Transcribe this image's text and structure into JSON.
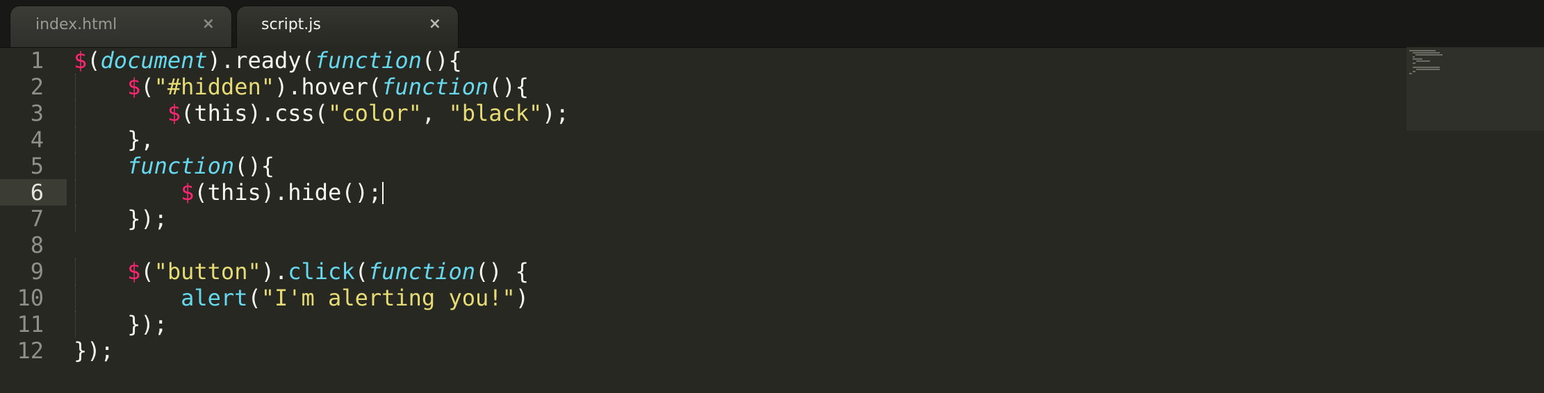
{
  "tabs": [
    {
      "label": "index.html",
      "close_glyph": "×",
      "active": false
    },
    {
      "label": "script.js",
      "close_glyph": "×",
      "active": true
    }
  ],
  "editor": {
    "current_line": 6,
    "lines": [
      {
        "number": "1",
        "tokens": [
          {
            "t": "$",
            "c": "dollar"
          },
          {
            "t": "(",
            "c": "plain"
          },
          {
            "t": "document",
            "c": "fn"
          },
          {
            "t": ").ready(",
            "c": "plain"
          },
          {
            "t": "function",
            "c": "fn"
          },
          {
            "t": "(){",
            "c": "plain"
          }
        ]
      },
      {
        "number": "2",
        "tokens": [
          {
            "t": "    ",
            "c": "plain"
          },
          {
            "t": "$",
            "c": "dollar"
          },
          {
            "t": "(",
            "c": "plain"
          },
          {
            "t": "\"#hidden\"",
            "c": "str"
          },
          {
            "t": ").hover(",
            "c": "plain"
          },
          {
            "t": "function",
            "c": "fn"
          },
          {
            "t": "(){",
            "c": "plain"
          }
        ]
      },
      {
        "number": "3",
        "tokens": [
          {
            "t": "       ",
            "c": "plain"
          },
          {
            "t": "$",
            "c": "dollar"
          },
          {
            "t": "(this).css(",
            "c": "plain"
          },
          {
            "t": "\"color\"",
            "c": "str"
          },
          {
            "t": ", ",
            "c": "plain"
          },
          {
            "t": "\"black\"",
            "c": "str"
          },
          {
            "t": ");",
            "c": "plain"
          }
        ]
      },
      {
        "number": "4",
        "tokens": [
          {
            "t": "    },",
            "c": "plain"
          }
        ]
      },
      {
        "number": "5",
        "tokens": [
          {
            "t": "    ",
            "c": "plain"
          },
          {
            "t": "function",
            "c": "fn"
          },
          {
            "t": "(){",
            "c": "plain"
          }
        ]
      },
      {
        "number": "6",
        "tokens": [
          {
            "t": "        ",
            "c": "plain"
          },
          {
            "t": "$",
            "c": "dollar"
          },
          {
            "t": "(this).hide();",
            "c": "plain"
          }
        ]
      },
      {
        "number": "7",
        "tokens": [
          {
            "t": "    });",
            "c": "plain"
          }
        ]
      },
      {
        "number": "8",
        "tokens": []
      },
      {
        "number": "9",
        "tokens": [
          {
            "t": "    ",
            "c": "plain"
          },
          {
            "t": "$",
            "c": "dollar"
          },
          {
            "t": "(",
            "c": "plain"
          },
          {
            "t": "\"button\"",
            "c": "str"
          },
          {
            "t": ").",
            "c": "plain"
          },
          {
            "t": "click",
            "c": "method"
          },
          {
            "t": "(",
            "c": "plain"
          },
          {
            "t": "function",
            "c": "fn"
          },
          {
            "t": "() {",
            "c": "plain"
          }
        ]
      },
      {
        "number": "10",
        "tokens": [
          {
            "t": "        ",
            "c": "plain"
          },
          {
            "t": "alert",
            "c": "method"
          },
          {
            "t": "(",
            "c": "plain"
          },
          {
            "t": "\"I'm alerting you!\"",
            "c": "str"
          },
          {
            "t": ")",
            "c": "plain"
          }
        ]
      },
      {
        "number": "11",
        "tokens": [
          {
            "t": "    });",
            "c": "plain"
          }
        ]
      },
      {
        "number": "12",
        "tokens": [
          {
            "t": "});",
            "c": "plain"
          }
        ]
      }
    ]
  },
  "colors": {
    "background": "#272822",
    "gutter_text": "#8f908a",
    "dollar": "#f92672",
    "function_keyword": "#66d9ef",
    "string": "#e6db74",
    "plain": "#f8f8f2"
  }
}
